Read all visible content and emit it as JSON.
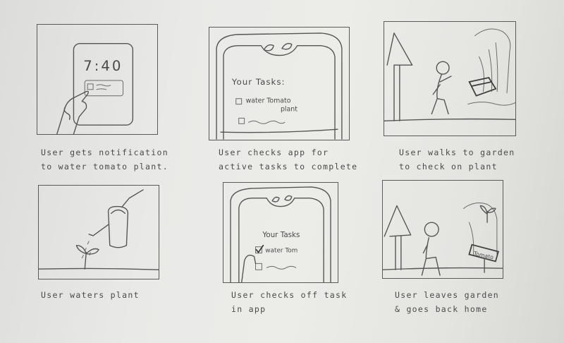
{
  "panels": [
    {
      "clock_time": "7:40",
      "caption_lines": [
        "User gets notification",
        "to water tomato plant."
      ]
    },
    {
      "tasks_heading": "Your Tasks:",
      "task_1": "water Tomato",
      "task_1b": "plant",
      "caption_lines": [
        "User checks app for",
        "active tasks to complete"
      ]
    },
    {
      "caption_lines": [
        "User walks to garden",
        "to check on plant"
      ]
    },
    {
      "caption_lines": [
        "User waters plant"
      ]
    },
    {
      "tasks_heading": "Your Tasks",
      "task_1": "water Tom",
      "caption_lines": [
        "User checks off task",
        "in app"
      ]
    },
    {
      "sign_text": "Tomato",
      "caption_lines": [
        "User leaves garden",
        "& goes back home"
      ]
    }
  ]
}
